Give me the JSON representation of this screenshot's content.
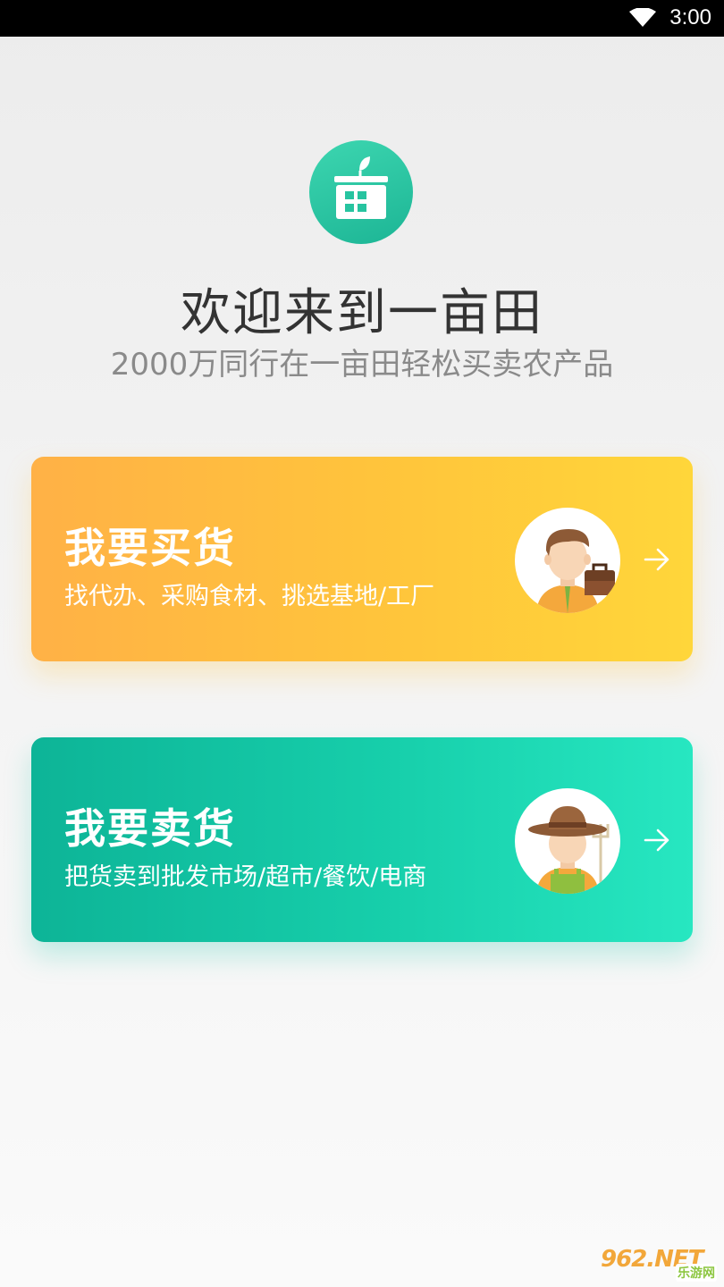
{
  "status_bar": {
    "time": "3:00",
    "wifi_icon": "wifi-icon"
  },
  "logo": {
    "icon": "app-logo-icon"
  },
  "welcome": {
    "title": "欢迎来到一亩田",
    "subtitle": "2000万同行在一亩田轻松买卖农产品"
  },
  "cards": {
    "buy": {
      "title": "我要买货",
      "description": "找代办、采购食材、挑选基地/工厂",
      "avatar_icon": "buyer-avatar-icon",
      "arrow_icon": "arrow-right-icon",
      "gradient": [
        "#ffb146",
        "#ffd63a"
      ]
    },
    "sell": {
      "title": "我要卖货",
      "description": "把货卖到批发市场/超市/餐饮/电商",
      "avatar_icon": "farmer-avatar-icon",
      "arrow_icon": "arrow-right-icon",
      "gradient": [
        "#0db497",
        "#27e7c1"
      ]
    }
  },
  "watermark": {
    "main": "962.NET",
    "sub": "乐游网"
  },
  "colors": {
    "accent": "#1fbf9a",
    "title": "#333333",
    "subtitle": "#8a8a8a"
  }
}
